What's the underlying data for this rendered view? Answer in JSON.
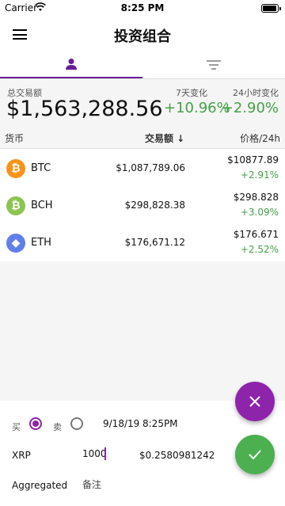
{
  "status_bar": {
    "carrier": "Carrier",
    "time": "8:25 PM"
  },
  "app_bar": {
    "title": "投资组合",
    "menu_icon": "menu-icon"
  },
  "tabs": [
    {
      "name": "portfolio",
      "icon": "person-icon",
      "active": true
    },
    {
      "name": "filter",
      "icon": "filter-icon",
      "active": false
    }
  ],
  "summary": {
    "total_label": "总交易额",
    "total_value": "$1,563,288.56",
    "change_7d_label": "7天变化",
    "change_7d_value": "+10.96%",
    "change_24h_label": "24小时变化",
    "change_24h_value": "+2.90%"
  },
  "table": {
    "headers": {
      "coin": "货币",
      "volume": "交易额 ↓",
      "price": "价格/24h"
    },
    "rows": [
      {
        "symbol": "BTC",
        "volume": "$1,087,789.06",
        "price": "$10877.89",
        "change": "+2.91%",
        "icon_letter": "₿",
        "icon_color": "#f7931a"
      },
      {
        "symbol": "BCH",
        "volume": "$298,828.38",
        "price": "$298.828",
        "change": "+3.09%",
        "icon_letter": "₿",
        "icon_color": "#8dc351"
      },
      {
        "symbol": "ETH",
        "volume": "$176,671.12",
        "price": "$176.671",
        "change": "+2.52%",
        "icon_letter": "◆",
        "icon_color": "#627eea"
      }
    ]
  },
  "form": {
    "buy_label": "买",
    "sell_label": "卖",
    "selected": "buy",
    "date": "9/18/19",
    "time": "8:25PM",
    "coin": "XRP",
    "quantity": "1000",
    "price": "$0.2580981242",
    "aggregated_label": "Aggregated",
    "note_placeholder": "备注"
  },
  "colors": {
    "accent": "#6a1b9a",
    "fab_close": "#8e24aa",
    "fab_confirm": "#4caf50",
    "positive": "#43a047"
  }
}
